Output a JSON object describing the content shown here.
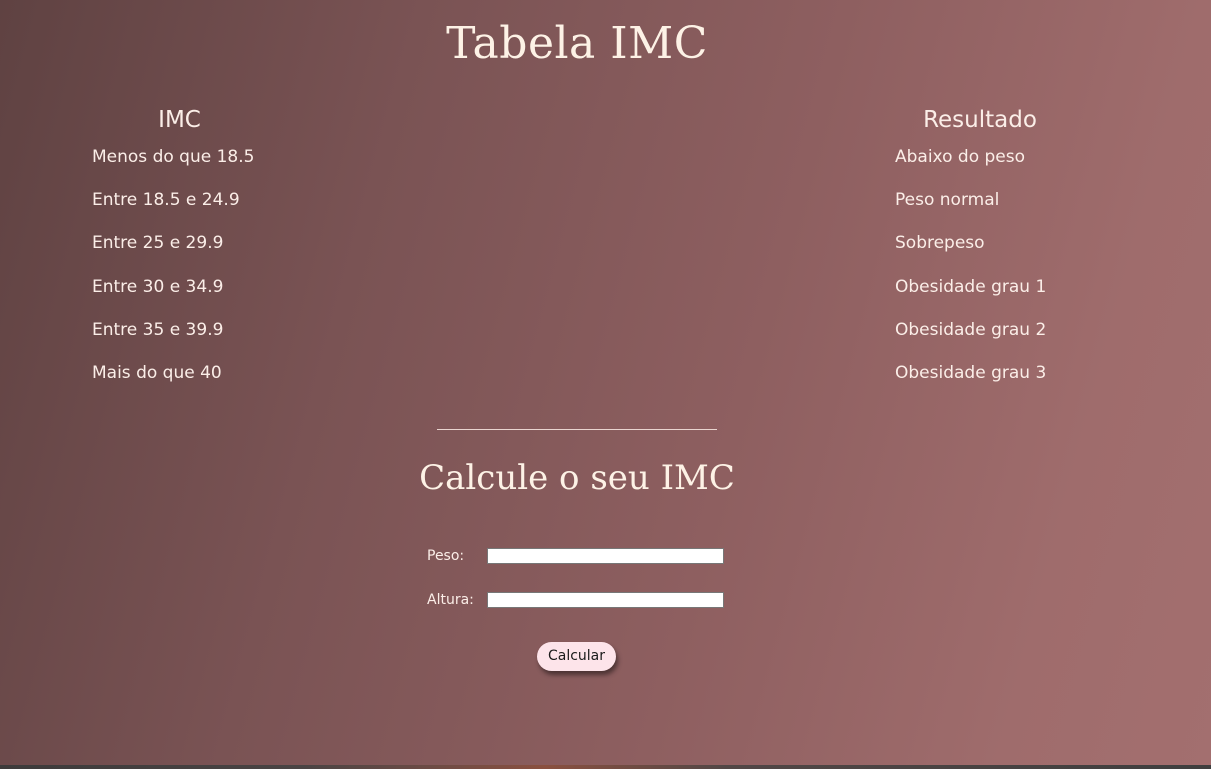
{
  "page": {
    "title": "Tabela IMC",
    "subtitle": "Calcule o seu IMC"
  },
  "table": {
    "imc_header": "IMC",
    "result_header": "Resultado",
    "imc_values": [
      "Menos do que 18.5",
      "Entre 18.5 e 24.9",
      "Entre 25 e 29.9",
      "Entre 30 e 34.9",
      "Entre 35 e 39.9",
      "Mais do que 40"
    ],
    "results": [
      "Abaixo do peso",
      "Peso normal",
      "Sobrepeso",
      "Obesidade grau 1",
      "Obesidade grau 2",
      "Obesidade grau 3"
    ]
  },
  "form": {
    "peso_label": "Peso:",
    "peso_value": "",
    "altura_label": "Altura:",
    "altura_value": "",
    "button_label": "Calcular"
  },
  "colors": {
    "background_dark": "#5f4242",
    "background_light": "#a36f6f",
    "text": "#fbeee8",
    "button_bg": "#fde4ea"
  }
}
